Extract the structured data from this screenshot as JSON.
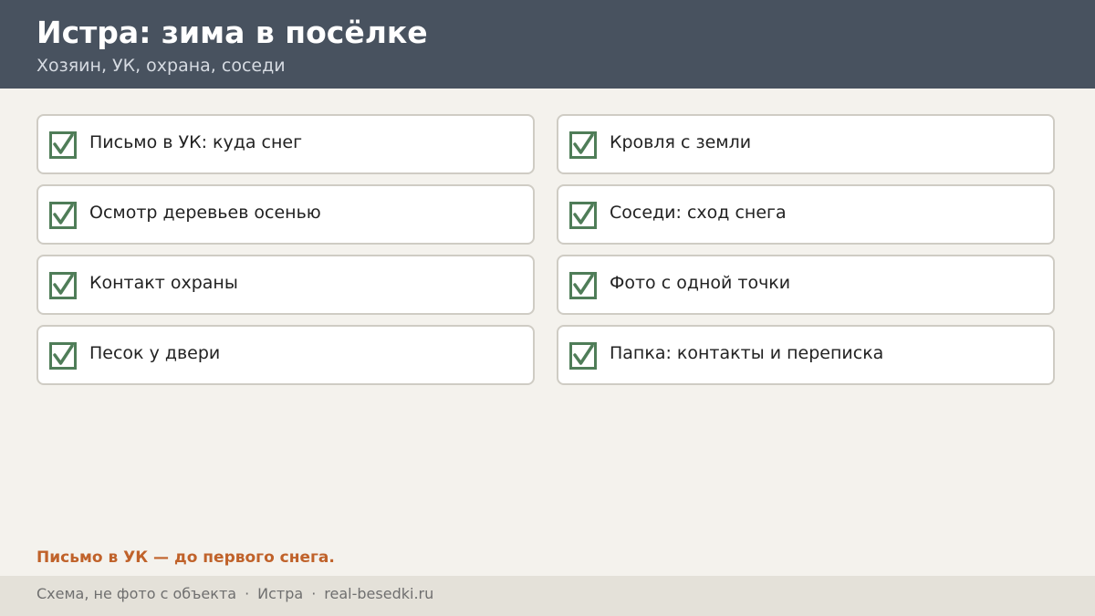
{
  "header": {
    "title": "Истра: зима в посёлке",
    "subtitle": "Хозяин, УК, охрана, соседи"
  },
  "checklist": {
    "left": [
      {
        "label": "Письмо в УК: куда снег",
        "checked": true
      },
      {
        "label": "Осмотр деревьев осенью",
        "checked": true
      },
      {
        "label": "Контакт охраны",
        "checked": true
      },
      {
        "label": "Песок у двери",
        "checked": true
      }
    ],
    "right": [
      {
        "label": "Кровля с земли",
        "checked": true
      },
      {
        "label": "Соседи: сход снега",
        "checked": true
      },
      {
        "label": "Фото с одной точки",
        "checked": true
      },
      {
        "label": "Папка: контакты и переписка",
        "checked": true
      }
    ]
  },
  "note": "Письмо в УК — до первого снега.",
  "footer": {
    "items": [
      "Схема, не фото с объекта",
      "Истра",
      "real-besedki.ru"
    ],
    "separator": "·"
  },
  "icons": {
    "check": "checkbox-checked-icon"
  },
  "colors": {
    "header_bg": "#48525f",
    "page_bg": "#f4f2ed",
    "check_green": "#4f7d58",
    "accent_orange": "#c0622a",
    "footer_bg": "#e4e1d9"
  }
}
